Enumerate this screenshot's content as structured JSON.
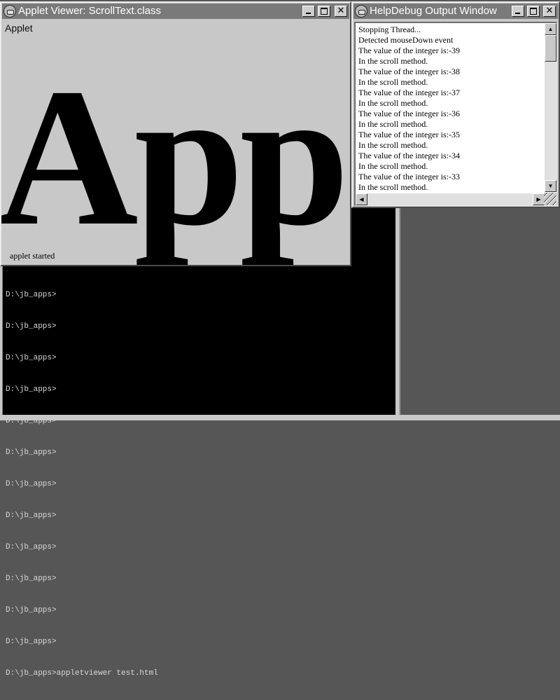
{
  "applet_window": {
    "title": "Applet Viewer: ScrollText.class",
    "menu_label": "Applet",
    "big_text": "App",
    "status": "applet started"
  },
  "debug_window": {
    "title": "HelpDebug Output Window",
    "lines": [
      "Stopping Thread...",
      "Detected mouseDown event",
      "The value of the integer is:-39",
      "In the scroll method.",
      "The value of the integer is:-38",
      "In the scroll method.",
      "The value of the integer is:-37",
      "In the scroll method.",
      "The value of the integer is:-36",
      "In the scroll method.",
      "The value of the integer is:-35",
      "In the scroll method.",
      "The value of the integer is:-34",
      "In the scroll method.",
      "The value of the integer is:-33",
      "In the scroll method."
    ]
  },
  "console": {
    "lines": [
      "D:\\jb_apps>",
      "D:\\jb_apps>",
      "D:\\jb_apps>",
      "D:\\jb_apps>",
      "D:\\jb_apps>",
      "D:\\jb_apps>",
      "D:\\jb_apps>",
      "D:\\jb_apps>",
      "D:\\jb_apps>",
      "D:\\jb_apps>",
      "D:\\jb_apps>",
      "D:\\jb_apps>",
      "D:\\jb_apps>appletviewer test.html"
    ]
  },
  "icons": {
    "window_icon": "java-coffee-cup-icon",
    "minimize": "minimize-icon",
    "maximize": "maximize-icon",
    "close": "close-icon"
  }
}
